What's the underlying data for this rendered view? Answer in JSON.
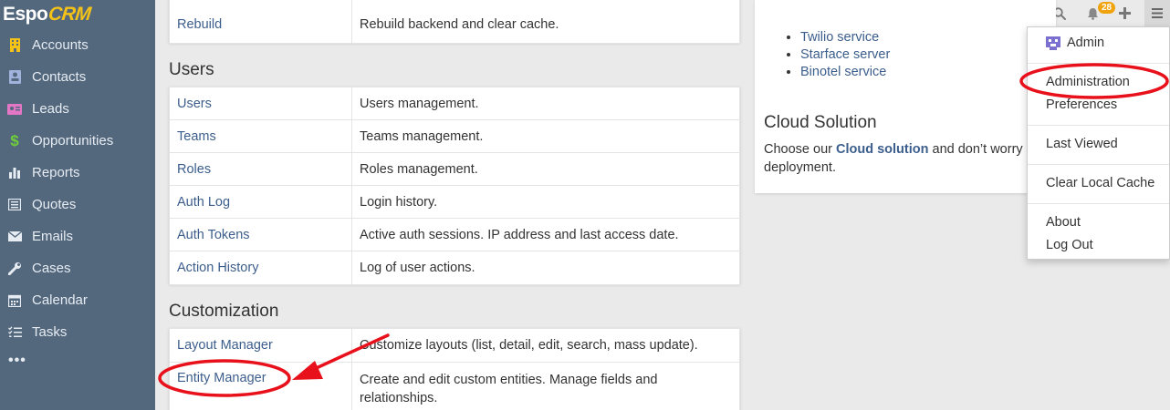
{
  "logo": {
    "espo": "Espo",
    "crm": "CRM"
  },
  "sidebar": {
    "items": [
      {
        "label": "Accounts",
        "icon": "building-icon"
      },
      {
        "label": "Contacts",
        "icon": "contact-card-icon"
      },
      {
        "label": "Leads",
        "icon": "id-card-icon"
      },
      {
        "label": "Opportunities",
        "icon": "dollar-icon"
      },
      {
        "label": "Reports",
        "icon": "bar-chart-icon"
      },
      {
        "label": "Quotes",
        "icon": "list-box-icon"
      },
      {
        "label": "Emails",
        "icon": "envelope-icon"
      },
      {
        "label": "Cases",
        "icon": "wrench-icon"
      },
      {
        "label": "Calendar",
        "icon": "calendar-icon"
      },
      {
        "label": "Tasks",
        "icon": "tasks-icon"
      }
    ],
    "more": "•••"
  },
  "topbar": {
    "search_placeholder": "Search",
    "notification_count": "28"
  },
  "sections": {
    "top_row": {
      "label": "Rebuild",
      "description": "Rebuild backend and clear cache."
    },
    "users": {
      "title": "Users",
      "rows": [
        {
          "label": "Users",
          "description": "Users management."
        },
        {
          "label": "Teams",
          "description": "Teams management."
        },
        {
          "label": "Roles",
          "description": "Roles management."
        },
        {
          "label": "Auth Log",
          "description": "Login history."
        },
        {
          "label": "Auth Tokens",
          "description": "Active auth sessions. IP address and last access date."
        },
        {
          "label": "Action History",
          "description": "Log of user actions."
        }
      ]
    },
    "customization": {
      "title": "Customization",
      "rows": [
        {
          "label": "Layout Manager",
          "description": "Customize layouts (list, detail, edit, search, mass update)."
        },
        {
          "label": "Entity Manager",
          "description": "Create and edit custom entities. Manage fields and relationships."
        }
      ]
    }
  },
  "right": {
    "integrations": [
      "Twilio service",
      "Starface server",
      "Binotel service"
    ],
    "cloud_title": "Cloud Solution",
    "cloud_text_before": "Choose our ",
    "cloud_link": "Cloud solution",
    "cloud_text_after": " and don’t worry a",
    "cloud_text_line2": "deployment."
  },
  "dropdown": {
    "admin": "Admin",
    "administration": "Administration",
    "preferences": "Preferences",
    "last_viewed": "Last Viewed",
    "clear_cache": "Clear Local Cache",
    "about": "About",
    "logout": "Log Out"
  },
  "colors": {
    "sidebar_bg": "#53677d",
    "link": "#3c5e8c",
    "annotation_red": "#e8101a",
    "badge": "#f0a30a",
    "logo_accent": "#f5c318"
  }
}
